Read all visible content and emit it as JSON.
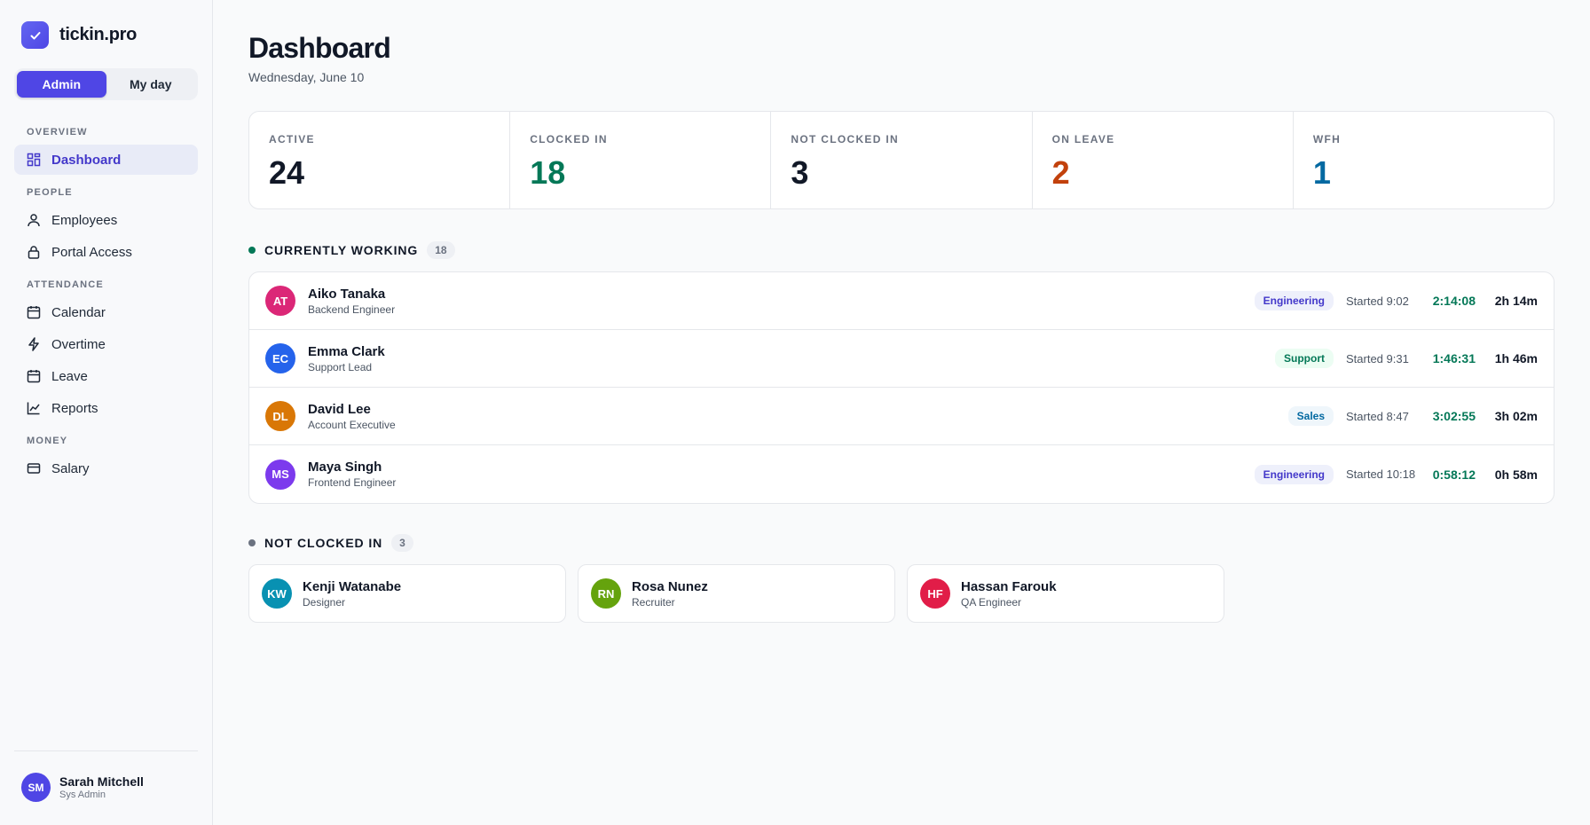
{
  "brand": {
    "name": "tickin.pro"
  },
  "mode": {
    "admin_label": "Admin",
    "myday_label": "My day"
  },
  "nav": {
    "sections": [
      {
        "label": "OVERVIEW",
        "items": [
          {
            "label": "Dashboard",
            "icon": "grid-icon",
            "active": true
          }
        ]
      },
      {
        "label": "PEOPLE",
        "items": [
          {
            "label": "Employees",
            "icon": "user-icon"
          },
          {
            "label": "Portal Access",
            "icon": "lock-icon"
          }
        ]
      },
      {
        "label": "ATTENDANCE",
        "items": [
          {
            "label": "Calendar",
            "icon": "calendar-icon"
          },
          {
            "label": "Overtime",
            "icon": "bolt-icon"
          },
          {
            "label": "Leave",
            "icon": "calendar-icon"
          },
          {
            "label": "Reports",
            "icon": "chart-icon"
          }
        ]
      },
      {
        "label": "MONEY",
        "items": [
          {
            "label": "Salary",
            "icon": "card-icon"
          }
        ]
      }
    ]
  },
  "user": {
    "initials": "SM",
    "name": "Sarah Mitchell",
    "role": "Sys Admin",
    "color": "#4f46e5"
  },
  "page": {
    "title": "Dashboard",
    "date": "Wednesday, June 10"
  },
  "stats": [
    {
      "label": "ACTIVE",
      "value": "24",
      "color": "#111827"
    },
    {
      "label": "CLOCKED IN",
      "value": "18",
      "color": "#047857"
    },
    {
      "label": "NOT CLOCKED IN",
      "value": "3",
      "color": "#111827"
    },
    {
      "label": "ON LEAVE",
      "value": "2",
      "color": "#c2410c"
    },
    {
      "label": "WFH",
      "value": "1",
      "color": "#0369a1"
    }
  ],
  "working": {
    "title": "CURRENTLY WORKING",
    "count": "18",
    "dot_color": "#047857",
    "rows": [
      {
        "initials": "AT",
        "name": "Aiko Tanaka",
        "role": "Backend Engineer",
        "avatar_color": "#db2777",
        "dept": "Engineering",
        "dept_fg": "#4338ca",
        "dept_bg": "#eef0fb",
        "started": "Started 9:02",
        "timer": "2:14:08",
        "total": "2h 14m"
      },
      {
        "initials": "EC",
        "name": "Emma Clark",
        "role": "Support Lead",
        "avatar_color": "#2563eb",
        "dept": "Support",
        "dept_fg": "#047857",
        "dept_bg": "#ecfdf3",
        "started": "Started 9:31",
        "timer": "1:46:31",
        "total": "1h 46m"
      },
      {
        "initials": "DL",
        "name": "David Lee",
        "role": "Account Executive",
        "avatar_color": "#d97706",
        "dept": "Sales",
        "dept_fg": "#0369a1",
        "dept_bg": "#eff6fb",
        "started": "Started 8:47",
        "timer": "3:02:55",
        "total": "3h 02m"
      },
      {
        "initials": "MS",
        "name": "Maya Singh",
        "role": "Frontend Engineer",
        "avatar_color": "#7c3aed",
        "dept": "Engineering",
        "dept_fg": "#4338ca",
        "dept_bg": "#eef0fb",
        "started": "Started 10:18",
        "timer": "0:58:12",
        "total": "0h 58m"
      }
    ]
  },
  "notin": {
    "title": "NOT CLOCKED IN",
    "count": "3",
    "dot_color": "#6b7280",
    "cards": [
      {
        "initials": "KW",
        "name": "Kenji Watanabe",
        "role": "Designer",
        "avatar_color": "#0891b2"
      },
      {
        "initials": "RN",
        "name": "Rosa Nunez",
        "role": "Recruiter",
        "avatar_color": "#65a30d"
      },
      {
        "initials": "HF",
        "name": "Hassan Farouk",
        "role": "QA Engineer",
        "avatar_color": "#e11d48"
      }
    ]
  }
}
